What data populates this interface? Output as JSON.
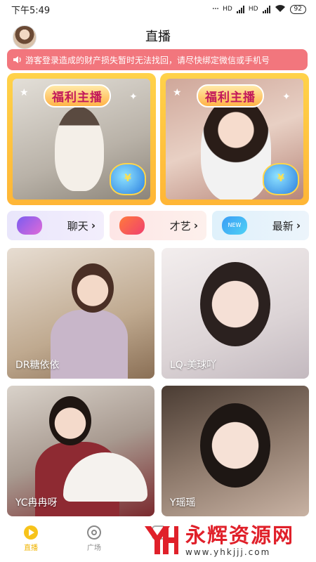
{
  "status_bar": {
    "time": "下午5:49",
    "network_labels": [
      "HD",
      "HD"
    ],
    "battery": "92"
  },
  "header": {
    "title": "直播"
  },
  "notice": {
    "text": "游客登录造成的财产损失暂时无法找回，请尽快绑定微信或手机号"
  },
  "banners": [
    {
      "badge": "福利主播"
    },
    {
      "badge": "福利主播"
    }
  ],
  "categories": [
    {
      "label": "聊天",
      "icon": "chat-bubble-icon"
    },
    {
      "label": "才艺",
      "icon": "talent-icon"
    },
    {
      "label": "最新",
      "icon": "new-icon",
      "icon_text": "NEW"
    }
  ],
  "streams": [
    {
      "name": "DR糖依依"
    },
    {
      "name": "LQ-美球吖"
    },
    {
      "name": "YC冉冉呀"
    },
    {
      "name": "Y瑶瑶"
    }
  ],
  "bottom_nav": {
    "items": [
      {
        "label": "直播",
        "icon": "live-play-icon",
        "active": true
      },
      {
        "label": "广场",
        "icon": "square-icon",
        "active": false
      }
    ]
  },
  "watermark": {
    "title": "永辉资源网",
    "url": "www.yhkjjj.com"
  },
  "colors": {
    "notice_bg": "#f2767d",
    "banner_gold": "#ffc43d",
    "active_nav": "#f7c31a",
    "watermark_red": "#e0202a"
  }
}
